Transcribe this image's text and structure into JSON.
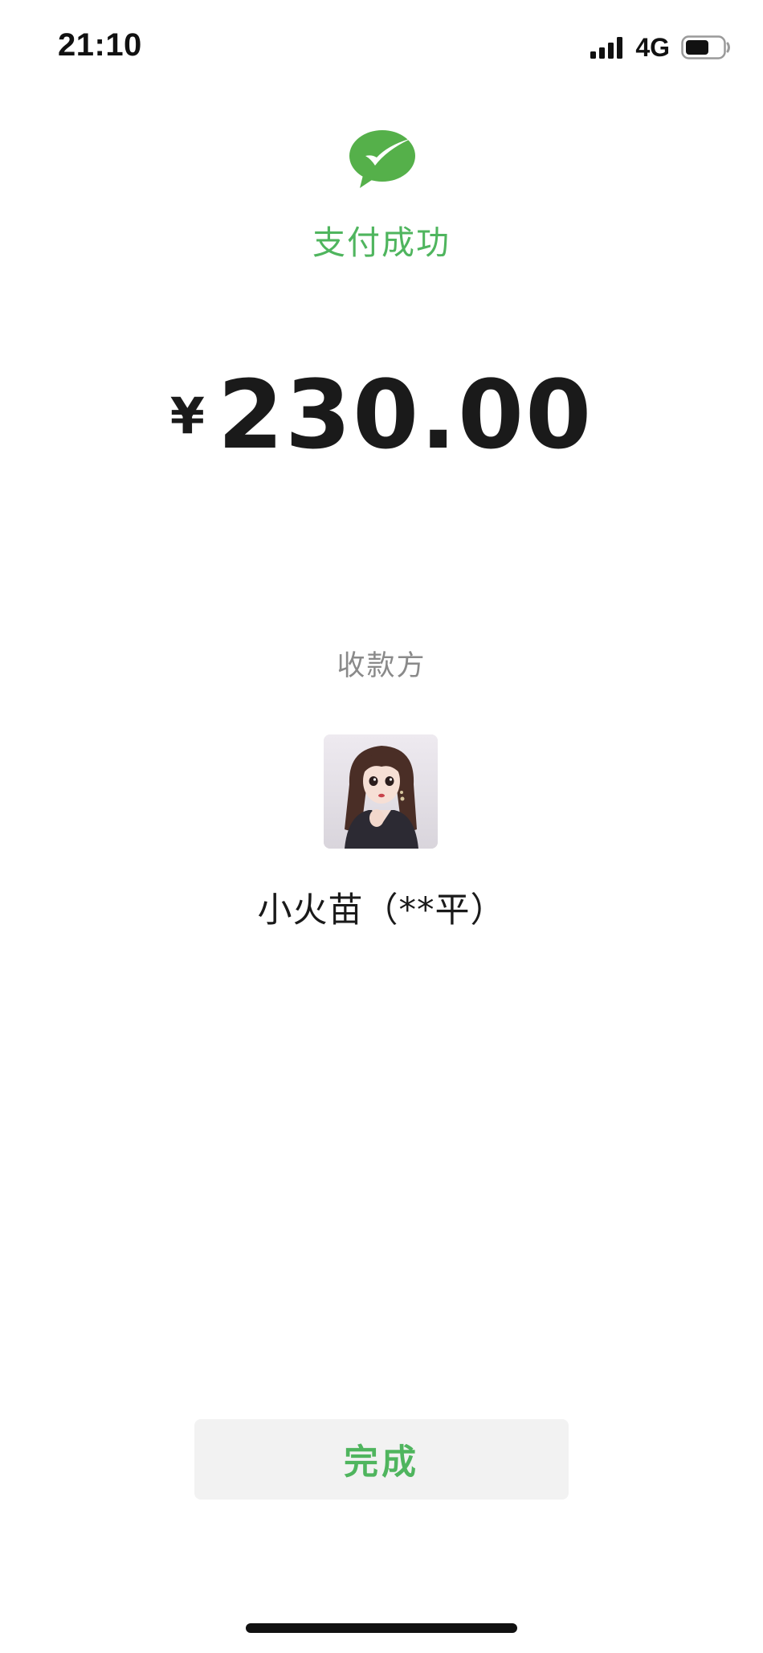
{
  "status_bar": {
    "time": "21:10",
    "network": "4G",
    "icons": [
      "signal-bars-icon",
      "battery-icon"
    ]
  },
  "header": {
    "logo_icon": "wechat-pay-check-icon",
    "title": "支付成功",
    "accent_color": "#4fb55e"
  },
  "payment": {
    "currency_symbol": "¥",
    "amount": "230.00"
  },
  "payee": {
    "label": "收款方",
    "avatar_icon": "user-avatar",
    "name": "小火苗（**平）"
  },
  "actions": {
    "done_label": "完成"
  }
}
